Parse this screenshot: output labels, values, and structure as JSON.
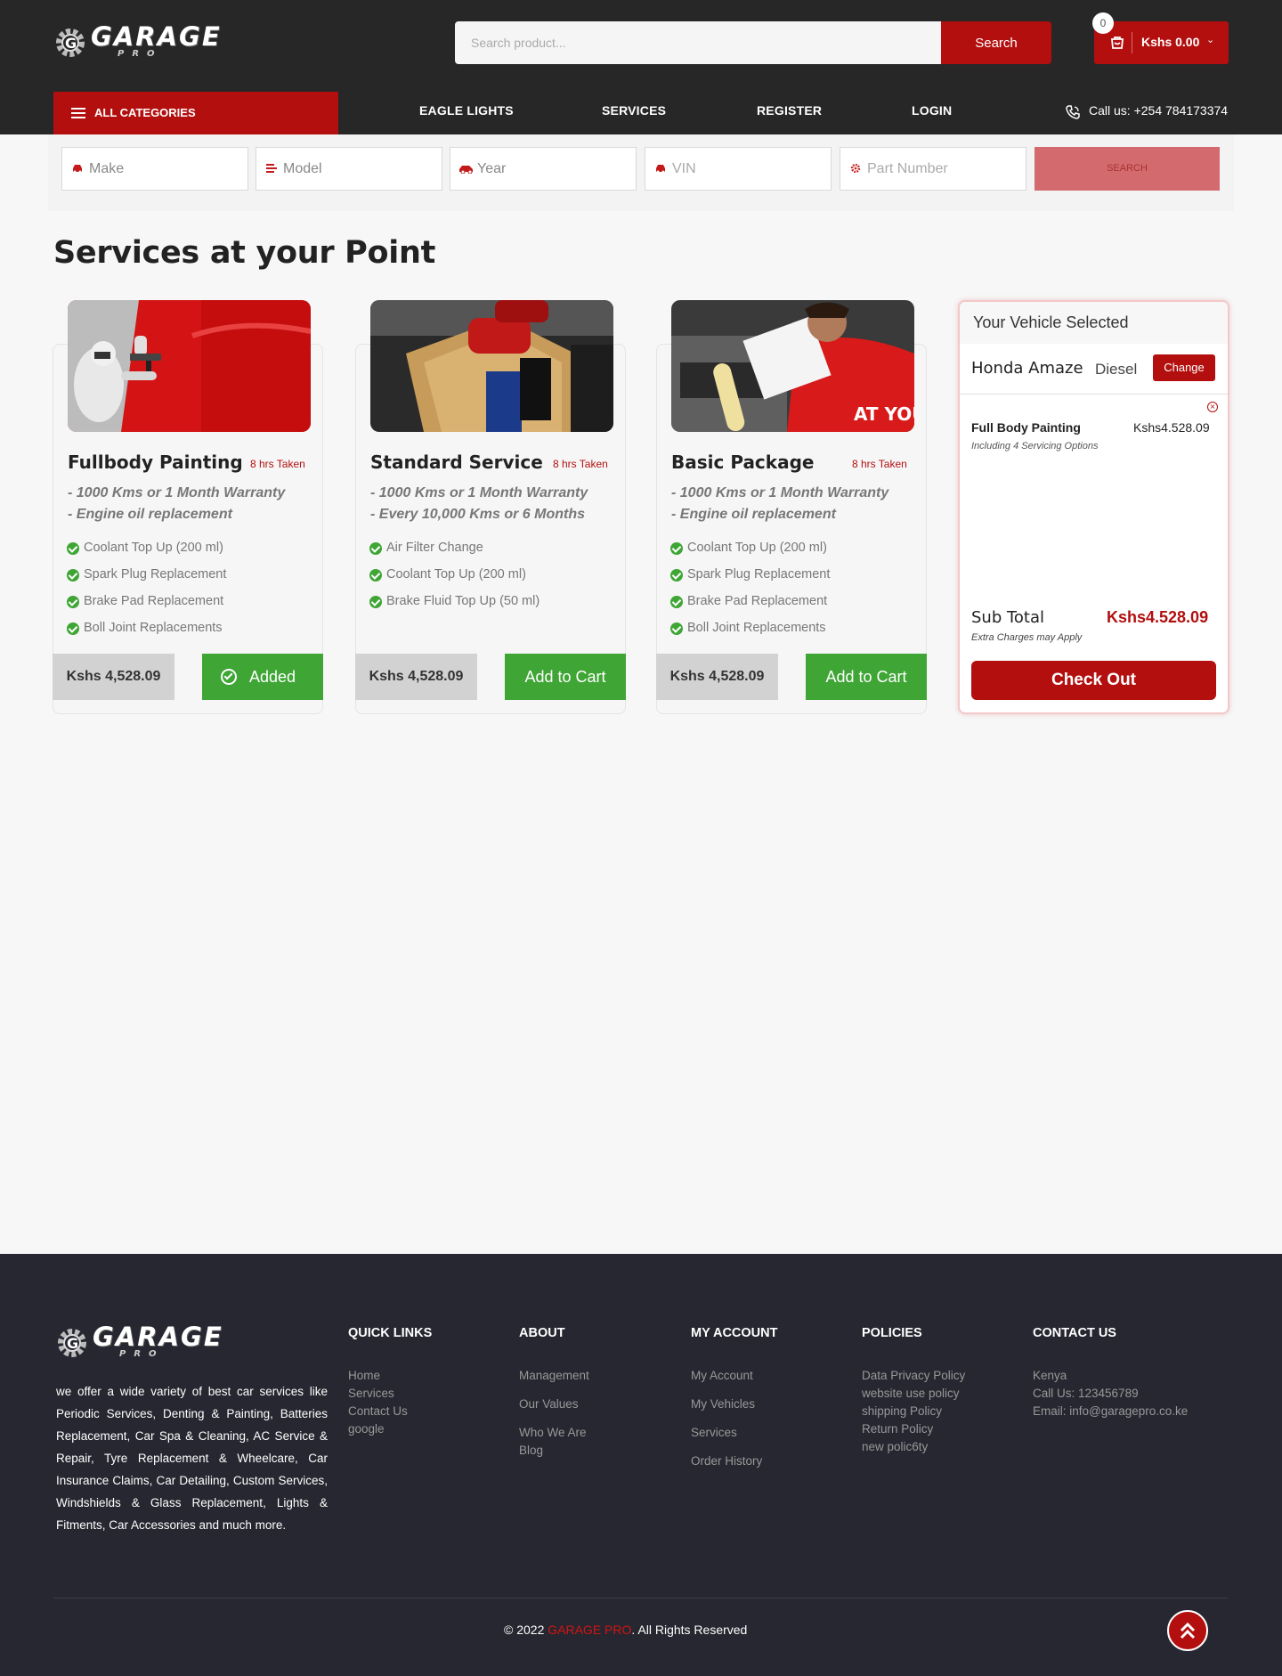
{
  "header": {
    "logo_text": "GARAGE",
    "logo_sub": "PRO",
    "search_placeholder": "Search product...",
    "search_button": "Search",
    "cart_count": "0",
    "cart_total": "Kshs 0.00"
  },
  "nav": {
    "all_categories": "ALL CATEGORIES",
    "links": [
      "EAGLE LIGHTS",
      "SERVICES",
      "REGISTER",
      "LOGIN"
    ],
    "call": "Call us: +254 784173374"
  },
  "filters": {
    "make": "Make",
    "model": "Model",
    "year": "Year",
    "vin": "VIN",
    "part_number": "Part Number",
    "search": "SEARCH"
  },
  "page_title": "Services at your Point",
  "services": [
    {
      "title": "Fullbody Painting",
      "time": "8 hrs Taken",
      "warranty": [
        "- 1000 Kms or 1 Month Warranty",
        "- Engine oil replacement"
      ],
      "features": [
        "Coolant Top Up (200 ml)",
        "Spark Plug Replacement",
        "Brake Pad Replacement",
        "Boll Joint Replacements"
      ],
      "price": "Kshs 4,528.09",
      "button": "Added"
    },
    {
      "title": "Standard Service",
      "time": "8 hrs Taken",
      "warranty": [
        "- 1000 Kms or 1 Month Warranty",
        "- Every 10,000 Kms or 6 Months"
      ],
      "features": [
        "Air Filter Change",
        "Coolant Top Up (200 ml)",
        "Brake Fluid Top Up (50 ml)"
      ],
      "price": "Kshs 4,528.09",
      "button": "Add to Cart"
    },
    {
      "title": "Basic Package",
      "time": "8 hrs Taken",
      "warranty": [
        "- 1000 Kms or 1 Month Warranty",
        "- Engine oil replacement"
      ],
      "features": [
        "Coolant Top Up (200 ml)",
        "Spark Plug Replacement",
        "Brake Pad Replacement",
        "Boll Joint Replacements"
      ],
      "price": "Kshs 4,528.09",
      "button": "Add to Cart"
    }
  ],
  "vehicle": {
    "heading": "Your Vehicle Selected",
    "name": "Honda Amaze",
    "fuel": "Diesel",
    "change": "Change",
    "item_name": "Full Body Painting",
    "item_price": "Kshs4.528.09",
    "item_sub": "Including 4 Servicing Options",
    "subtotal_label": "Sub Total",
    "subtotal_value": "Kshs4.528.09",
    "extra": "Extra Charges may Apply",
    "checkout": "Check Out"
  },
  "footer": {
    "description": "we offer a wide variety of best car services like Periodic Services, Denting & Painting, Batteries Replacement, Car Spa & Cleaning, AC Service & Repair, Tyre Replacement & Wheelcare, Car Insurance Claims, Car Detailing, Custom Services, Windshields & Glass Replacement, Lights & Fitments, Car Accessories and much more.",
    "quick_links": {
      "title": "QUICK LINKS",
      "items": [
        "Home",
        "Services",
        "Contact Us",
        "google"
      ]
    },
    "about": {
      "title": "ABOUT",
      "items": [
        "Management",
        "Our Values",
        "Who We Are",
        "Blog"
      ]
    },
    "my_account": {
      "title": "MY ACCOUNT",
      "items": [
        "My Account",
        "My Vehicles",
        "Services",
        "Order History"
      ]
    },
    "policies": {
      "title": "POLICIES",
      "items": [
        "Data Privacy Policy",
        "website use policy",
        "shipping Policy",
        "Return Policy",
        "new polic6ty"
      ]
    },
    "contact": {
      "title": "CONTACT US",
      "items": [
        "Kenya",
        "Call Us: 123456789",
        "Email: info@garagepro.co.ke"
      ]
    },
    "copyright_pre": "© 2022 ",
    "copyright_brand": "GARAGE PRO",
    "copyright_post": ". All Rights Reserved"
  },
  "colors": {
    "brand_red": "#b30f0f",
    "green": "#3fa535",
    "dark": "#272727"
  }
}
